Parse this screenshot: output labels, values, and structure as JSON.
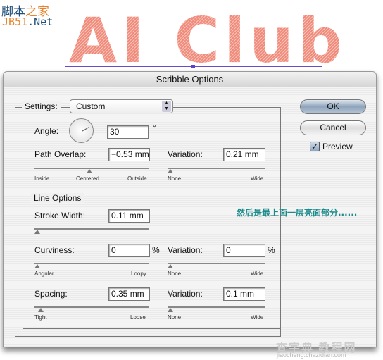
{
  "watermark_top": {
    "line1_a": "脚本",
    "line1_b": "之家",
    "line2_a": "JB51",
    "line2_b": ".Net"
  },
  "artwork": {
    "text": "AI Club",
    "color": "#f08a7a"
  },
  "dialog": {
    "title": "Scribble Options",
    "settings": {
      "label": "Settings:",
      "value": "Custom"
    },
    "angle": {
      "label": "Angle:",
      "value": "30",
      "unit": "°"
    },
    "path_overlap": {
      "label": "Path Overlap:",
      "value": "−0.53 mm",
      "slider_labels": [
        "Inside",
        "Centered",
        "Outside"
      ]
    },
    "path_overlap_variation": {
      "label": "Variation:",
      "value": "0.21 mm",
      "slider_labels": [
        "None",
        "Wide"
      ]
    },
    "line_options": {
      "title": "Line Options",
      "stroke_width": {
        "label": "Stroke Width:",
        "value": "0.11 mm"
      },
      "curviness": {
        "label": "Curviness:",
        "value": "0",
        "unit": "%",
        "slider_labels": [
          "Angular",
          "Loopy"
        ]
      },
      "curviness_variation": {
        "label": "Variation:",
        "value": "0",
        "unit": "%",
        "slider_labels": [
          "None",
          "Wide"
        ]
      },
      "spacing": {
        "label": "Spacing:",
        "value": "0.35 mm",
        "slider_labels": [
          "Tight",
          "Loose"
        ]
      },
      "spacing_variation": {
        "label": "Variation:",
        "value": "0.1 mm",
        "slider_labels": [
          "None",
          "Wide"
        ]
      }
    },
    "ok_label": "OK",
    "cancel_label": "Cancel",
    "preview": {
      "label": "Preview",
      "checked": true
    }
  },
  "annotation": "然后是最上面一层亮面部分......",
  "watermark_bottom": {
    "name": "查字典 教程网",
    "url": "jiaocheng.chazidian.com"
  }
}
